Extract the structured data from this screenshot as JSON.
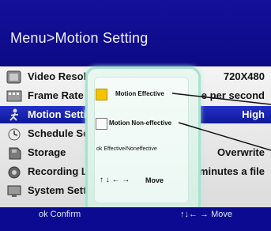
{
  "header": {
    "title": "Menu>Motion Setting"
  },
  "menu": {
    "items": [
      {
        "label": "Video Resolu",
        "value": "720X480"
      },
      {
        "label": "Frame Rate",
        "value": "rame per second"
      },
      {
        "label": "Motion Setti",
        "value": "High"
      },
      {
        "label": "Schedule Se",
        "value": ""
      },
      {
        "label": "Storage",
        "value": "Overwrite"
      },
      {
        "label": "Recording Le",
        "value": "30 minutes a file"
      },
      {
        "label": "System Sett",
        "value": ""
      }
    ]
  },
  "popup": {
    "option_effective": "Motion Effective",
    "option_non_effective": "Motion Non-effective",
    "ok_hint": "ok  Effective/Noneffective",
    "move_arrows": "↑ ↓ ←  →",
    "move_label": "Move"
  },
  "footer": {
    "confirm": "ok Confirm",
    "move": "↑↓← → Move"
  },
  "colors": {
    "accent_blue": "#0e0a9e",
    "selected_row": "#1f2cbe",
    "effective_box": "#f4c400",
    "popup_bg": "#e2f5ec"
  }
}
